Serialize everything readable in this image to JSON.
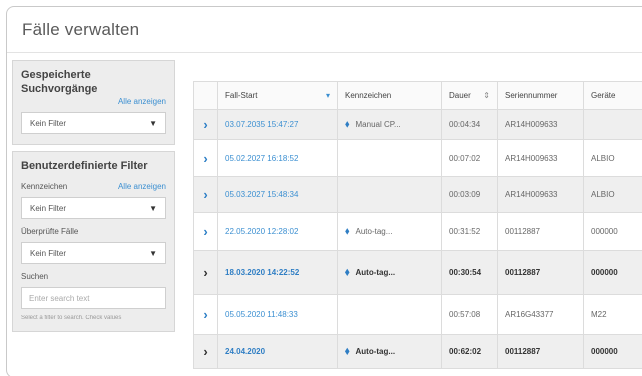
{
  "page": {
    "title": "Fälle verwalten"
  },
  "saved_searches": {
    "title": "Gespeicherte Suchvorgänge",
    "show_all": "Alle anzeigen",
    "filter_value": "Kein Filter"
  },
  "custom_filters": {
    "title": "Benutzerdefinierte Filter",
    "tag_label": "Kennzeichen",
    "tag_show_all": "Alle anzeigen",
    "tag_filter_value": "Kein Filter",
    "reviewed_label": "Überprüfte Fälle",
    "reviewed_filter_value": "Kein Filter",
    "search_label": "Suchen",
    "search_placeholder": "Enter search text",
    "search_note": "Select a filter to search. Check values"
  },
  "table": {
    "columns": [
      "",
      "Fall-Start",
      "Kennzeichen",
      "Dauer",
      "Seriennummer",
      "Geräte"
    ],
    "rows": [
      {
        "date": "03.07.2035 15:47:27",
        "tag": "Manual CP...",
        "duration": "00:04:34",
        "serial": "AR14H009633",
        "device": ""
      },
      {
        "date": "05.02.2027 16:18:52",
        "tag": "",
        "duration": "00:07:02",
        "serial": "AR14H009633",
        "device": "ALBIO"
      },
      {
        "date": "05.03.2027 15:48:34",
        "tag": "",
        "duration": "00:03:09",
        "serial": "AR14H009633",
        "device": "ALBIO"
      },
      {
        "date": "22.05.2020 12:28:02",
        "tag": "Auto-tag...",
        "duration": "00:31:52",
        "serial": "00112887",
        "device": "000000"
      },
      {
        "date": "18.03.2020 14:22:52",
        "tag": "Auto-tag...",
        "duration": "00:30:54",
        "serial": "00112887",
        "device": "000000"
      },
      {
        "date": "05.05.2020 11:48:33",
        "tag": "",
        "duration": "00:57:08",
        "serial": "AR16G43377",
        "device": "M22"
      },
      {
        "date": "24.04.2020",
        "tag": "Auto-tag...",
        "duration": "00:62:02",
        "serial": "00112887",
        "device": "000000"
      }
    ]
  },
  "icons": {
    "expand": "chevron-right-icon",
    "tag": "tag-icon",
    "dropdown": "caret-down-icon"
  },
  "colors": {
    "link": "#3b8fd1",
    "accent": "#2f7ec4"
  }
}
